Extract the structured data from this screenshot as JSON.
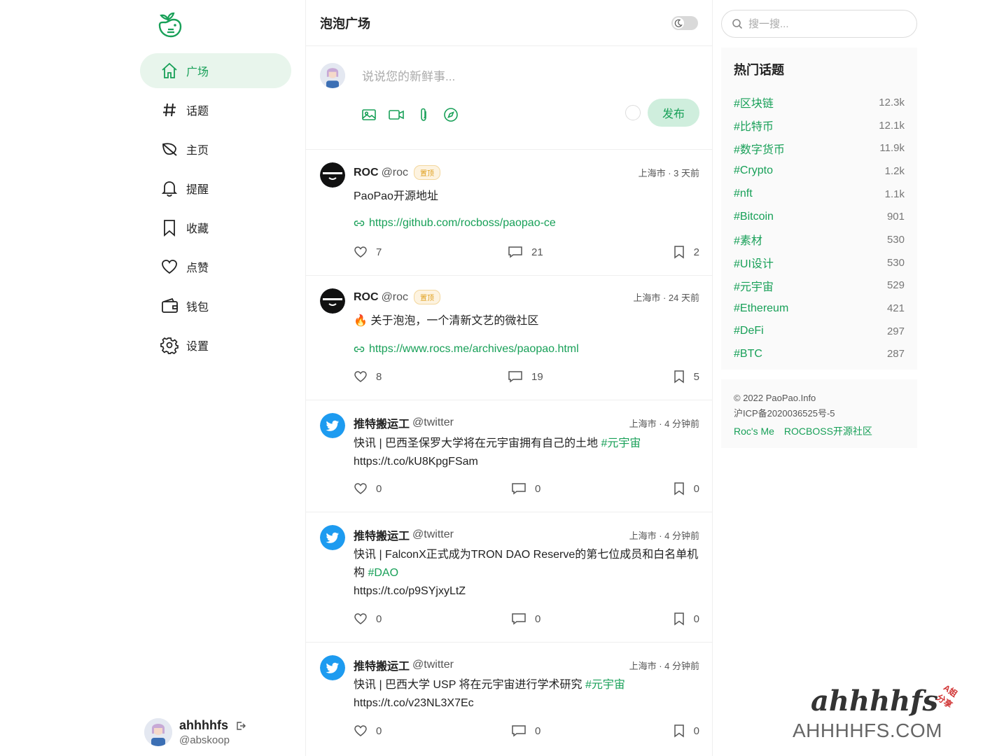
{
  "sidebar": {
    "items": [
      {
        "label": "广场",
        "icon": "home-icon",
        "active": true
      },
      {
        "label": "话题",
        "icon": "hashtag-icon",
        "active": false
      },
      {
        "label": "主页",
        "icon": "leaf-icon",
        "active": false
      },
      {
        "label": "提醒",
        "icon": "bell-icon",
        "active": false
      },
      {
        "label": "收藏",
        "icon": "bookmark-icon",
        "active": false
      },
      {
        "label": "点赞",
        "icon": "heart-icon",
        "active": false
      },
      {
        "label": "钱包",
        "icon": "wallet-icon",
        "active": false
      },
      {
        "label": "设置",
        "icon": "gear-icon",
        "active": false
      }
    ],
    "user": {
      "name": "ahhhhfs",
      "handle": "@abskoop"
    }
  },
  "feed": {
    "title": "泡泡广场",
    "composer": {
      "placeholder": "说说您的新鲜事...",
      "publish_label": "发布"
    },
    "posts": [
      {
        "name": "ROC",
        "handle": "@roc",
        "badge": "置顶",
        "meta": "上海市 · 3 天前",
        "text": "PaoPao开源地址",
        "link": "https://github.com/rocboss/paopao-ce",
        "likes": "7",
        "comments": "21",
        "collects": "2"
      },
      {
        "name": "ROC",
        "handle": "@roc",
        "badge": "置顶",
        "meta": "上海市 · 24 天前",
        "text": "🔥 关于泡泡，一个清新文艺的微社区",
        "link": "https://www.rocs.me/archives/paopao.html",
        "likes": "8",
        "comments": "19",
        "collects": "5"
      },
      {
        "name": "推特搬运工",
        "handle": "@twitter",
        "meta": "上海市 · 4 分钟前",
        "text": "快讯 | 巴西圣保罗大学将在元宇宙拥有自己的土地 ",
        "tag": "#元宇宙",
        "url": "https://t.co/kU8KpgFSam",
        "likes": "0",
        "comments": "0",
        "collects": "0"
      },
      {
        "name": "推特搬运工",
        "handle": "@twitter",
        "meta": "上海市 · 4 分钟前",
        "text": "快讯 | FalconX正式成为TRON DAO Reserve的第七位成员和白名单机构 ",
        "tag": "#DAO",
        "url": "https://t.co/p9SYjxyLtZ",
        "likes": "0",
        "comments": "0",
        "collects": "0"
      },
      {
        "name": "推特搬运工",
        "handle": "@twitter",
        "meta": "上海市 · 4 分钟前",
        "text": "快讯 | 巴西大学 USP 将在元宇宙进行学术研究 ",
        "tag": "#元宇宙",
        "url": "https://t.co/v23NL3X7Ec",
        "likes": "0",
        "comments": "0",
        "collects": "0"
      }
    ]
  },
  "right": {
    "search_placeholder": "搜一搜...",
    "topics_title": "热门话题",
    "topics": [
      {
        "name": "#区块链",
        "count": "12.3k"
      },
      {
        "name": "#比特币",
        "count": "12.1k"
      },
      {
        "name": "#数字货币",
        "count": "11.9k"
      },
      {
        "name": "#Crypto",
        "count": "1.2k"
      },
      {
        "name": "#nft",
        "count": "1.1k"
      },
      {
        "name": "#Bitcoin",
        "count": "901"
      },
      {
        "name": "#素材",
        "count": "530"
      },
      {
        "name": "#UI设计",
        "count": "530"
      },
      {
        "name": "#元宇宙",
        "count": "529"
      },
      {
        "name": "#Ethereum",
        "count": "421"
      },
      {
        "name": "#DeFi",
        "count": "297"
      },
      {
        "name": "#BTC",
        "count": "287"
      }
    ],
    "copyright": "© 2022 PaoPao.Info",
    "icp": "沪ICP备2020036525号-5",
    "links": [
      "Roc's Me",
      "ROCBOSS开源社区"
    ]
  },
  "watermark": {
    "script": "ahhhhfs",
    "tag": "A姐分享",
    "url": "AHHHHFS.COM"
  },
  "colors": {
    "accent": "#18a058",
    "accent_bg": "#e8f5ec",
    "twitter": "#1d9bf0"
  }
}
